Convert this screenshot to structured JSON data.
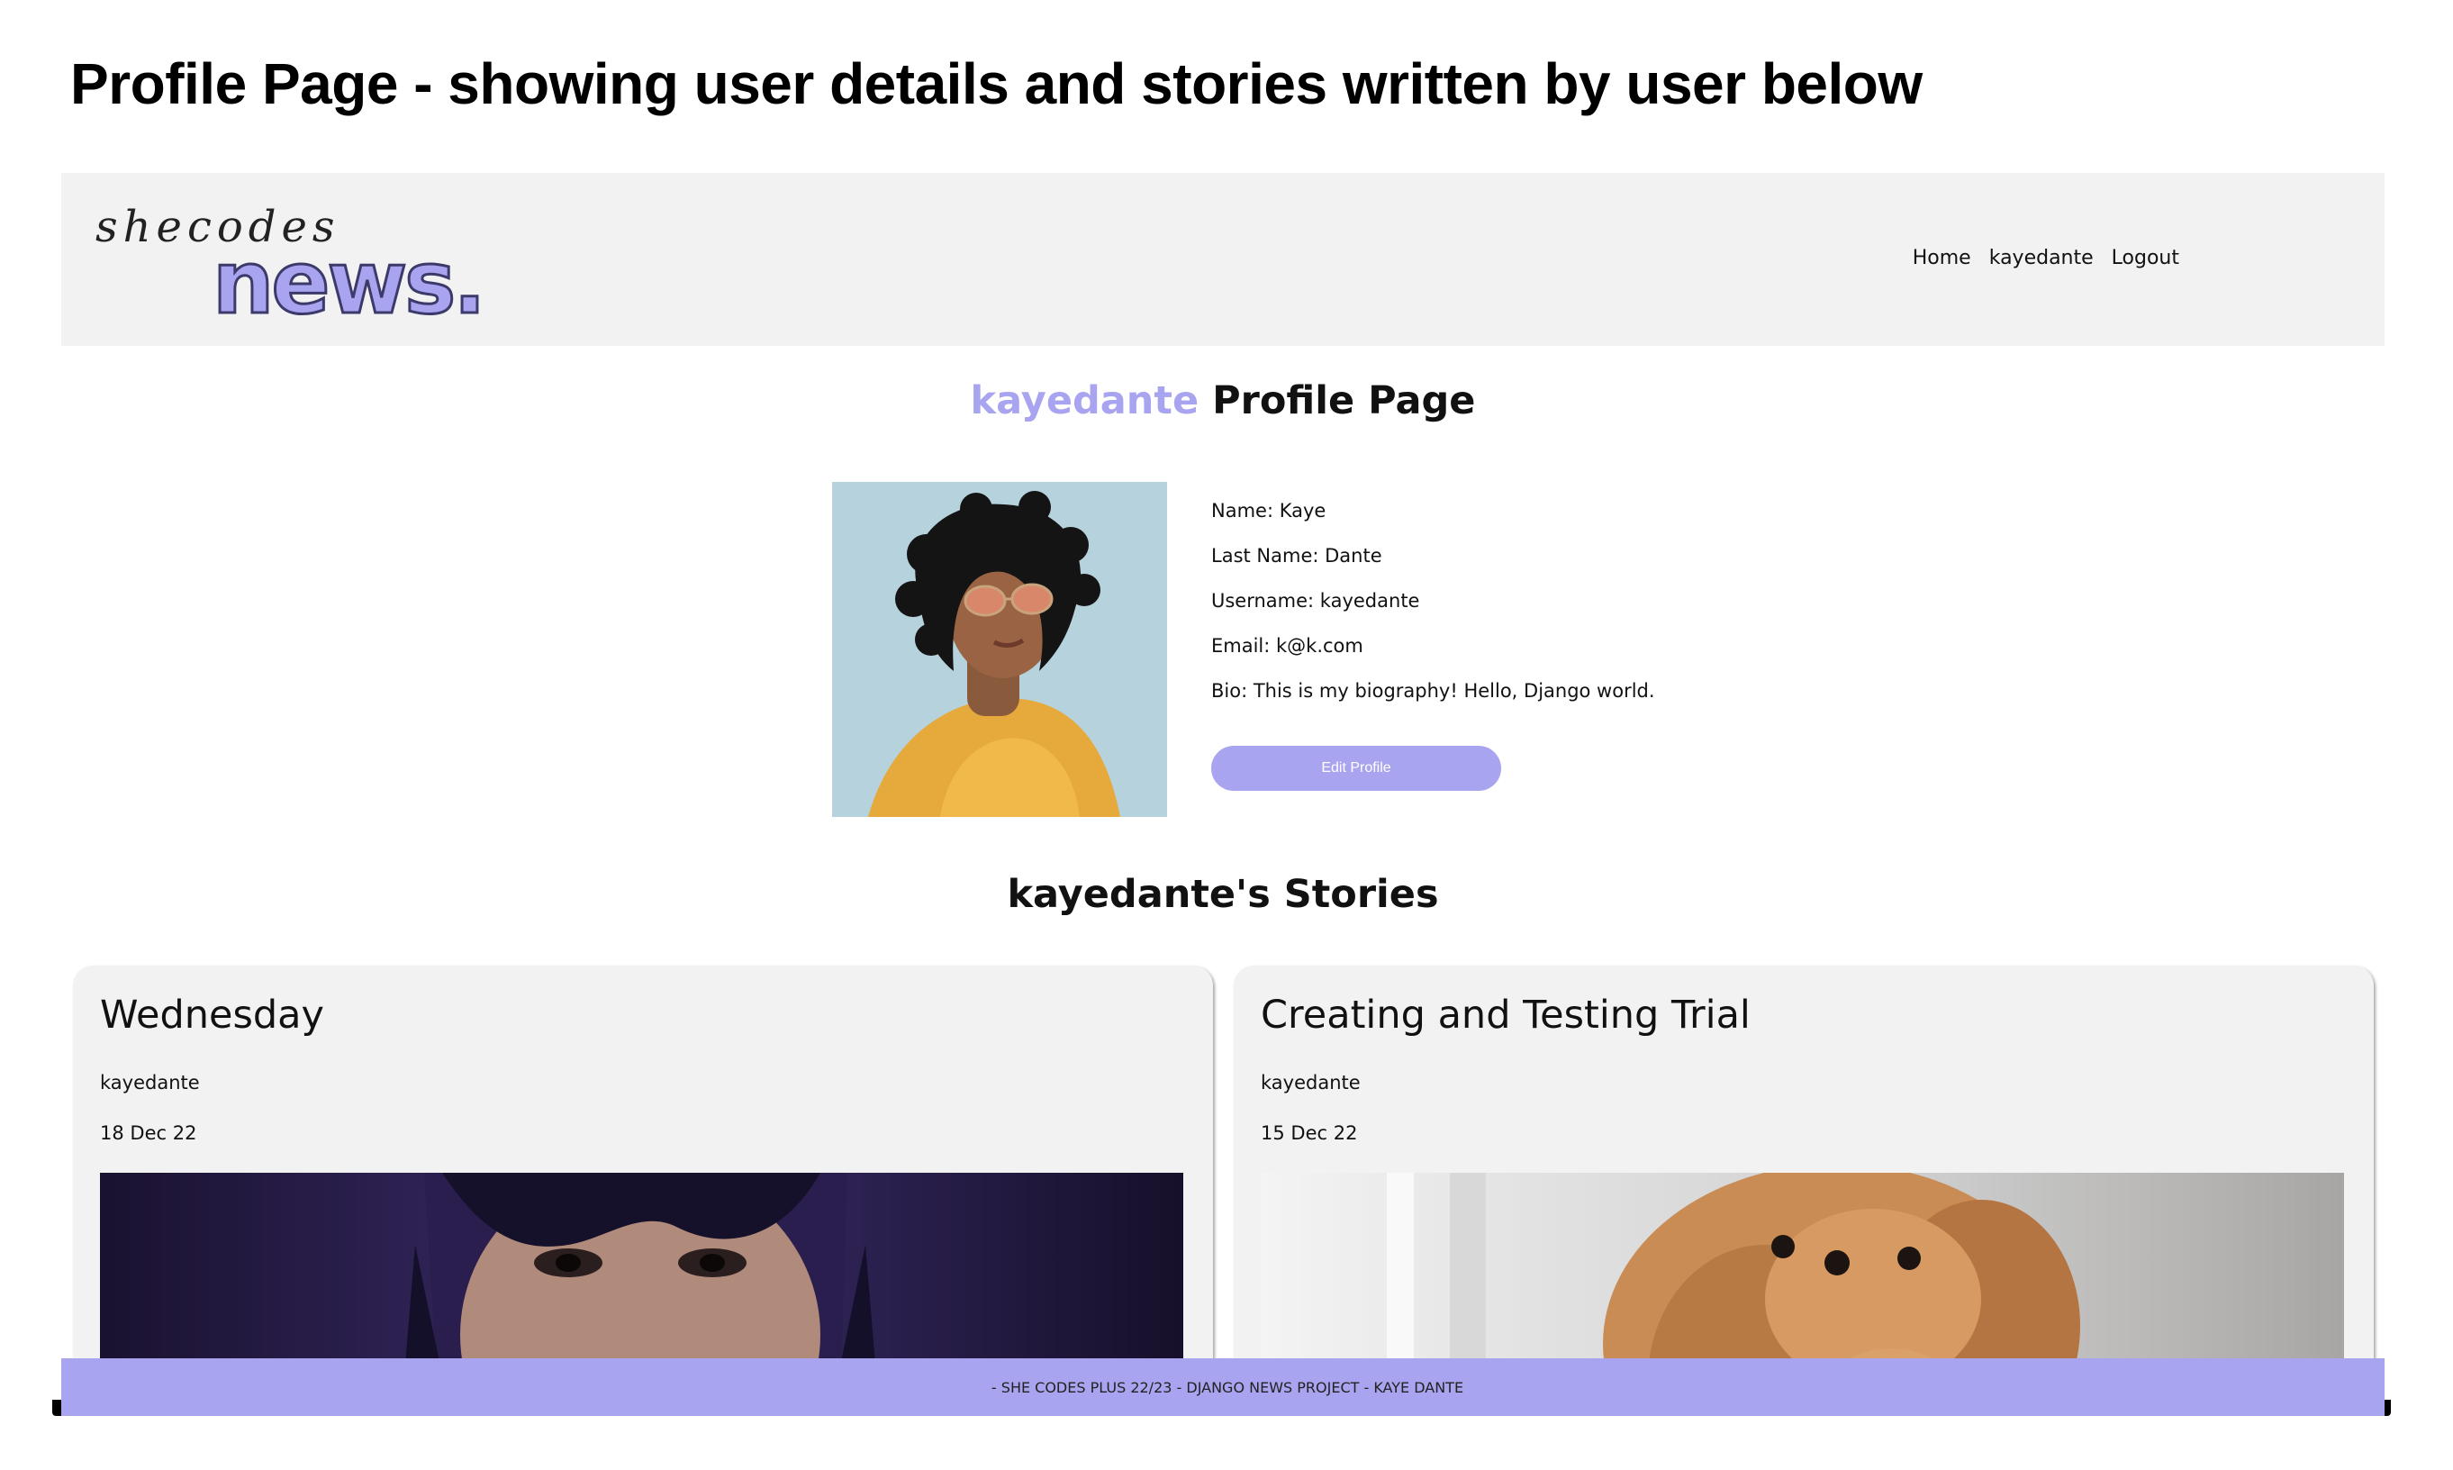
{
  "caption": "Profile Page - showing user details and stories written by user below",
  "logo": {
    "script": "shecodes",
    "main": "news."
  },
  "nav": {
    "home": "Home",
    "user": "kayedante",
    "logout": "Logout"
  },
  "profile": {
    "heading_username": "kayedante",
    "heading_suffix": "Profile Page",
    "name": "Name: Kaye",
    "last_name": "Last Name: Dante",
    "username": "Username: kayedante",
    "email": "Email: k@k.com",
    "bio": "Bio: This is my biography! Hello, Django world.",
    "edit_button": "Edit Profile"
  },
  "stories": {
    "heading": "kayedante's Stories",
    "items": [
      {
        "title": "Wednesday",
        "author": "kayedante",
        "date": "18 Dec 22"
      },
      {
        "title": "Creating and Testing Trial",
        "author": "kayedante",
        "date": "15 Dec 22"
      }
    ]
  },
  "footer": {
    "text": "- SHE CODES PLUS 22/23 - DJANGO NEWS PROJECT - KAYE DANTE"
  },
  "colors": {
    "accent": "#a9a4ef",
    "navbar_bg": "#f2f2f2",
    "card_bg": "#f2f2f2"
  }
}
